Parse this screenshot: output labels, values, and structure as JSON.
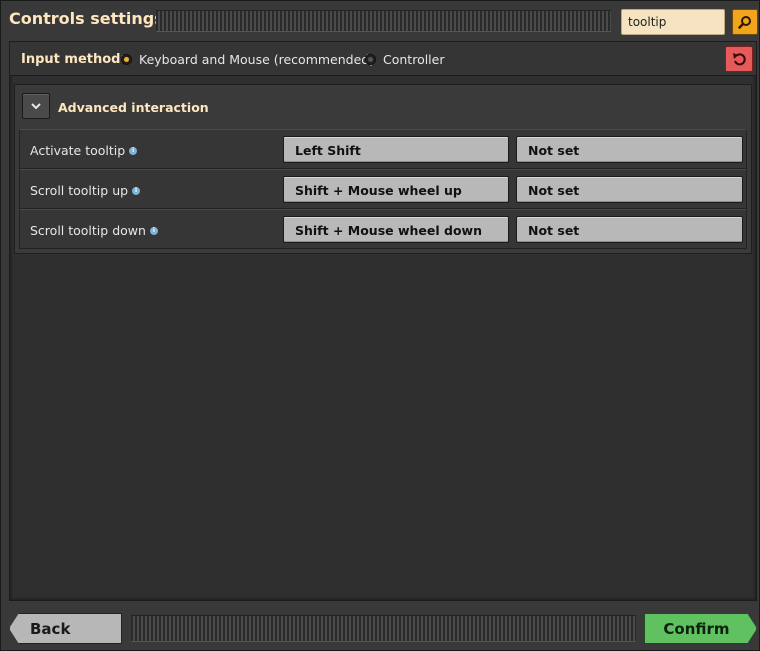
{
  "window": {
    "title": "Controls settings",
    "search": {
      "value": "tooltip",
      "placeholder": ""
    }
  },
  "input_method": {
    "label": "Input method:",
    "options": [
      {
        "label": "Keyboard and Mouse (recommended)",
        "selected": true
      },
      {
        "label": "Controller",
        "selected": false
      }
    ]
  },
  "section": {
    "title": "Advanced interaction",
    "expanded": true,
    "rows": [
      {
        "label": "Activate tooltip",
        "primary": "Left Shift",
        "secondary": "Not set"
      },
      {
        "label": "Scroll tooltip up",
        "primary": "Shift + Mouse wheel up",
        "secondary": "Not set"
      },
      {
        "label": "Scroll tooltip down",
        "primary": "Shift + Mouse wheel down",
        "secondary": "Not set"
      }
    ]
  },
  "footer": {
    "back_label": "Back",
    "confirm_label": "Confirm"
  },
  "colors": {
    "title_text": "#ffe6c0",
    "search_bg": "#f5e3c2",
    "search_button": "#f2a51c",
    "reset_button": "#e75a5a",
    "confirm_button": "#5fc15f",
    "bind_button": "#b8b8b8",
    "info_icon": "#7fb2d6"
  },
  "icons": {
    "search": "magnifier-icon",
    "reset": "reset-icon",
    "collapse": "chevron-down-icon",
    "info": "info-icon"
  }
}
